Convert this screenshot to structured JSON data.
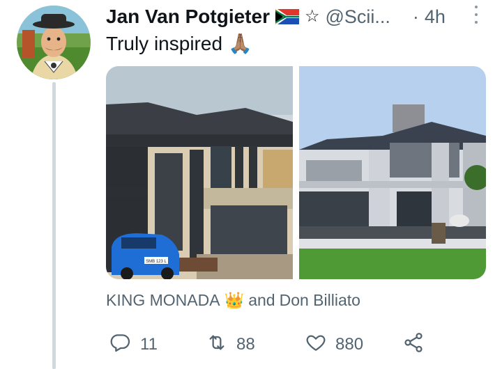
{
  "tweet": {
    "author_name": "Jan Van Potgieter",
    "handle": "@Scii...",
    "separator": "·",
    "time": "4h",
    "text": "Truly inspired",
    "emoji": "🙏🏽"
  },
  "media_tags": {
    "user1": "KING MONADA",
    "emoji": "👑",
    "connector": "and",
    "user2": "Don Billiato"
  },
  "actions": {
    "reply_count": "11",
    "retweet_count": "88",
    "like_count": "880"
  },
  "car_plate": "SMB 123 L",
  "colors": {
    "text_primary": "#0f1419",
    "text_secondary": "#536471",
    "thread_line": "#cfd9de"
  },
  "icons": [
    "reply-icon",
    "retweet-icon",
    "like-icon",
    "share-icon",
    "more-icon",
    "star-icon",
    "flag-icon"
  ]
}
